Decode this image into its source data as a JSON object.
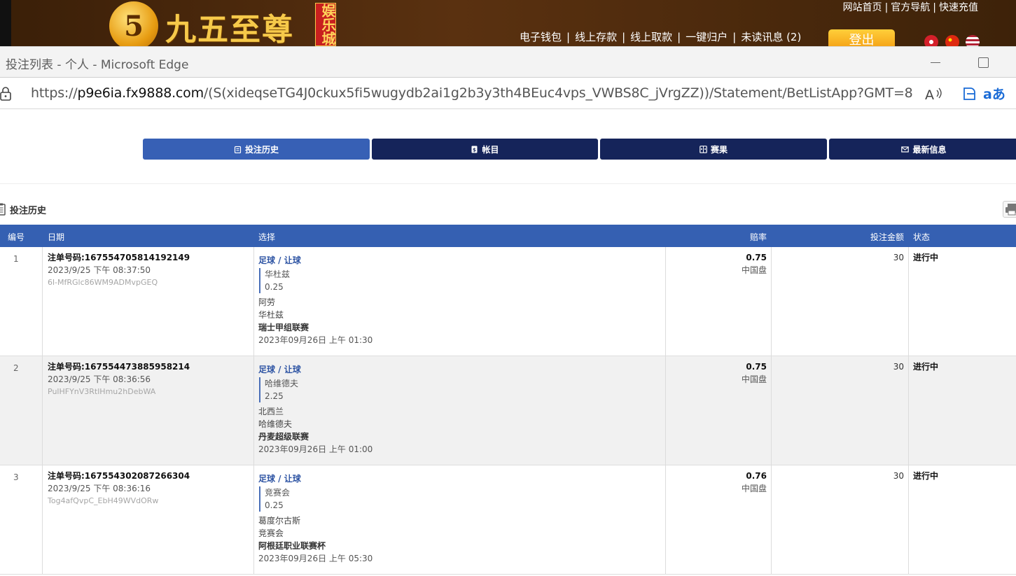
{
  "site": {
    "logo_digit": "5",
    "logo_text": "九五至尊",
    "logo_tag": "娱乐城",
    "top_links": [
      "网站首页",
      "官方导航",
      "快速充值"
    ],
    "main_links": [
      "电子钱包",
      "线上存款",
      "线上取款",
      "一键归户",
      "未读讯息 (2)"
    ],
    "login_label": "登出"
  },
  "window": {
    "title": "投注列表 - 个人 - Microsoft Edge",
    "url_prefix": "https://",
    "url_host": "p9e6ia.fx9888.com",
    "url_rest": "/(S(xideqseTG4J0ckux5fi5wugydb2ai1g2b3y3th4BEuc4vps_VWBS8C_jVrgZZ))/Statement/BetListApp?GMT=8",
    "translate_label": "aあ"
  },
  "tabs": [
    {
      "label": "投注历史",
      "icon": "clipboard-icon",
      "active": true
    },
    {
      "label": "帐目",
      "icon": "ledger-icon",
      "active": false
    },
    {
      "label": "赛果",
      "icon": "scoreboard-icon",
      "active": false
    },
    {
      "label": "最新信息",
      "icon": "mail-icon",
      "active": false
    }
  ],
  "section_title": "投注历史",
  "table": {
    "headers": {
      "no": "编号",
      "date": "日期",
      "selection": "选择",
      "odds": "赔率",
      "amount": "投注金额",
      "status": "状态"
    },
    "rows": [
      {
        "no": "1",
        "order": "注单号码:167554705814192149",
        "datetime": "2023/9/25 下午 08:37:50",
        "hash": "6l-MfRGlc86WM9ADMvpGEQ",
        "sport": "足球 / 让球",
        "pick": "华杜兹",
        "handicap": "0.25",
        "home": "阿劳",
        "away": "华杜兹",
        "league": "瑞士甲组联赛",
        "match_time": "2023年09月26日 上午 01:30",
        "odds": "0.75",
        "odds_type": "中国盘",
        "amount": "30",
        "status": "进行中"
      },
      {
        "no": "2",
        "order": "注单号码:167554473885958214",
        "datetime": "2023/9/25 下午 08:36:56",
        "hash": "PulHFYnV3RtlHmu2hDebWA",
        "sport": "足球 / 让球",
        "pick": "哈维德夫",
        "handicap": "2.25",
        "home": "北西兰",
        "away": "哈维德夫",
        "league": "丹麦超级联赛",
        "match_time": "2023年09月26日 上午 01:00",
        "odds": "0.75",
        "odds_type": "中国盘",
        "amount": "30",
        "status": "进行中"
      },
      {
        "no": "3",
        "order": "注单号码:167554302087266304",
        "datetime": "2023/9/25 下午 08:36:16",
        "hash": "Tog4afQvpC_EbH49WVdORw",
        "sport": "足球 / 让球",
        "pick": "竞赛会",
        "handicap": "0.25",
        "home": "葛度尔古斯",
        "away": "竞赛会",
        "league": "阿根廷职业联赛杯",
        "match_time": "2023年09月26日 上午 05:30",
        "odds": "0.76",
        "odds_type": "中国盘",
        "amount": "30",
        "status": "进行中"
      }
    ]
  }
}
